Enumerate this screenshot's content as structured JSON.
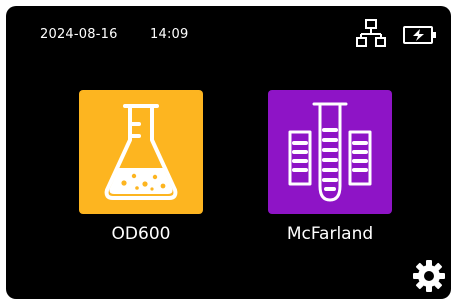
{
  "status_bar": {
    "date": "2024-08-16",
    "time": "14:09",
    "network_icon": "network-icon",
    "battery_icon": "battery-charging-icon"
  },
  "apps": [
    {
      "label": "OD600",
      "icon": "flask-icon",
      "color": "#fdb520"
    },
    {
      "label": "McFarland",
      "icon": "test-tube-icon",
      "color": "#8e14c6"
    }
  ],
  "settings": {
    "icon": "gear-icon"
  },
  "colors": {
    "background": "#000000",
    "text": "#ffffff"
  }
}
